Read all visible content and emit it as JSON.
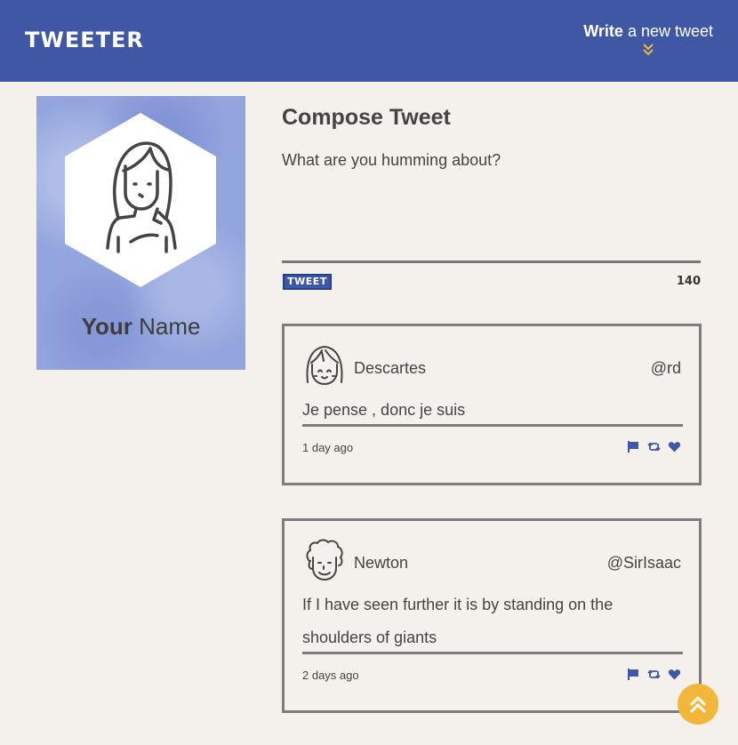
{
  "nav": {
    "logo": "TWEETER",
    "write_bold": "Write",
    "write_rest": " a new tweet"
  },
  "profile": {
    "name_bold": "Your",
    "name_rest": " Name"
  },
  "compose": {
    "title": "Compose Tweet",
    "placeholder": "What are you humming about?",
    "button_label": "TWEET",
    "counter": "140"
  },
  "tweets": [
    {
      "name": "Descartes",
      "handle": "@rd",
      "body": "Je pense , donc je suis",
      "time": "1 day ago"
    },
    {
      "name": "Newton",
      "handle": "@SirIsaac",
      "body": "If I have seen further it is by standing on the shoulders of giants",
      "time": "2 days ago"
    }
  ],
  "colors": {
    "brand": "#3f57a4",
    "accent": "#f2b63a",
    "background": "#f4f1ec"
  },
  "icons": [
    "chevron-down-double-icon",
    "flag-icon",
    "retweet-icon",
    "heart-icon",
    "chevron-up-double-icon"
  ]
}
